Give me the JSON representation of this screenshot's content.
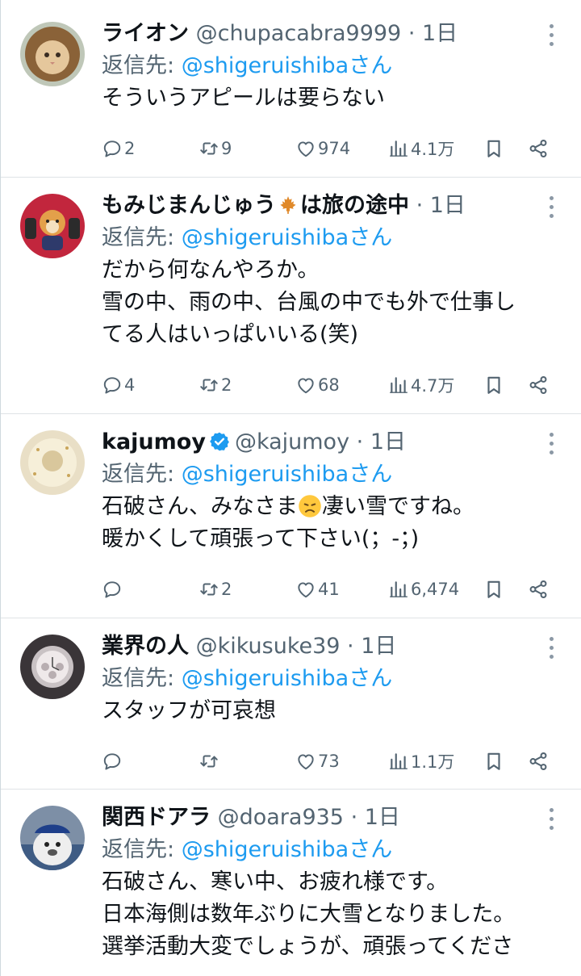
{
  "tweets": [
    {
      "name": "ライオン",
      "handle": "@chupacabra9999",
      "time": "1日",
      "reply_prefix": "返信先:",
      "reply_to": "@shigeruishibaさん",
      "lines": [
        "そういうアピールは要らない"
      ],
      "replies": "2",
      "retweets": "9",
      "likes": "974",
      "views": "4.1万"
    },
    {
      "name": "もみじまんじゅう",
      "name_suffix": "は旅の途中",
      "handle": "",
      "time": "1日",
      "reply_prefix": "返信先:",
      "reply_to": "@shigeruishibaさん",
      "lines": [
        "だから何なんやろか。",
        "雪の中、雨の中、台風の中でも外で仕事し",
        "てる人はいっぱいいる(笑)"
      ],
      "replies": "4",
      "retweets": "2",
      "likes": "68",
      "views": "4.7万"
    },
    {
      "name": "kajumoy",
      "handle": "@kajumoy",
      "time": "1日",
      "reply_prefix": "返信先:",
      "reply_to": "@shigeruishibaさん",
      "line1_a": "石破さん、みなさま",
      "line1_b": "凄い雪ですね。",
      "line2": "暖かくして頑張って下さい(；-；)",
      "replies": "",
      "retweets": "2",
      "likes": "41",
      "views": "6,474"
    },
    {
      "name": "業界の人",
      "handle": "@kikusuke39",
      "time": "1日",
      "reply_prefix": "返信先:",
      "reply_to": "@shigeruishibaさん",
      "lines": [
        "スタッフが可哀想"
      ],
      "replies": "",
      "retweets": "",
      "likes": "73",
      "views": "1.1万"
    },
    {
      "name": "関西ドアラ",
      "handle": "@doara935",
      "time": "1日",
      "reply_prefix": "返信先:",
      "reply_to": "@shigeruishibaさん",
      "lines": [
        "石破さん、寒い中、お疲れ様です。",
        "日本海側は数年ぶりに大雪となりました。",
        "選挙活動大変でしょうが、頑張ってくださ"
      ]
    }
  ],
  "colors": {
    "link": "#1d9bf0",
    "muted": "#536471",
    "text": "#0f1419"
  },
  "icons": [
    "reply-icon",
    "retweet-icon",
    "like-icon",
    "views-icon",
    "bookmark-icon",
    "share-icon",
    "more-icon",
    "verified-badge-icon",
    "maple-leaf-icon",
    "sad-face-emoji"
  ]
}
